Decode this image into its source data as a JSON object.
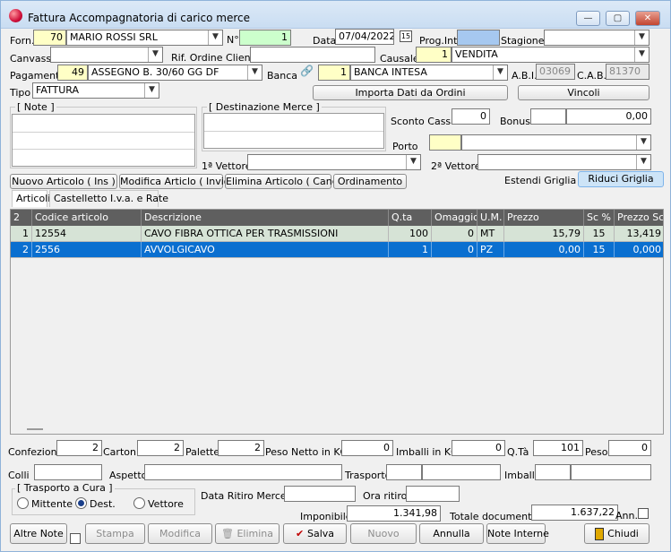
{
  "window": {
    "title": "Fattura Accompagnatoria di carico merce"
  },
  "header": {
    "forn_label": "Forn.",
    "forn_code": "70",
    "forn_name": "MARIO ROSSI SRL",
    "n_label": "N°",
    "n_value": "1",
    "data_label": "Data",
    "data_value": "07/04/2022",
    "calendar_icon": "15",
    "prog_label": "Prog.Int.",
    "prog_value": "",
    "stagione_label": "Stagione",
    "stagione_value": "",
    "canvass_label": "Canvass",
    "canvass_value": "",
    "rif_label": "Rif. Ordine Cliente",
    "rif_value": "",
    "causale_label": "Causale",
    "causale_code": "1",
    "causale_name": "VENDITA",
    "pagamento_label": "Pagamento",
    "pagamento_code": "49",
    "pagamento_name": "ASSEGNO B. 30/60 GG DF",
    "banca_label": "Banca",
    "banca_code": "1",
    "banca_name": "BANCA INTESA",
    "abi_label": "A.B.I.",
    "abi_value": "03069",
    "cab_label": "C.A.B.",
    "cab_value": "81370",
    "tipo_label": "Tipo",
    "tipo_value": "FATTURA",
    "importa_button": "Importa Dati da Ordini",
    "vincoli_button": "Vincoli",
    "note_title": "[ Note ]",
    "dest_title": "[ Destinazione Merce  ]",
    "sconto_label": "Sconto Cassa",
    "sconto_value": "0",
    "bonus_label": "Bonus",
    "bonus_value": "0,00",
    "porto_label": "Porto",
    "porto_code": "",
    "porto_name": "",
    "vettore1_label": "1ª Vettore",
    "vettore1_value": "",
    "vettore2_label": "2ª Vettore",
    "vettore2_value": ""
  },
  "toolbar": {
    "nuovo_articolo": "Nuovo Articolo ( Ins )",
    "modifica_articolo": "Modifica Articlo ( Invio )",
    "elimina_articolo": "Elimina Articolo ( Canc )",
    "ordinamento": "Ordinamento",
    "estendi": "Estendi Griglia",
    "riduci": "Riduci Griglia"
  },
  "tabs": [
    {
      "label": "Articoli"
    },
    {
      "label": "Castelletto I.v.a. e Rate"
    }
  ],
  "grid": {
    "columns": [
      "2",
      "Codice articolo",
      "Descrizione",
      "Q.ta",
      "Omaggio",
      "U.M.",
      "Prezzo",
      "Sc %",
      "Prezzo Sc"
    ],
    "rows": [
      {
        "n": "1",
        "codice": "12554",
        "descrizione": "CAVO FIBRA OTTICA PER TRASMISSIONI",
        "qta": "100",
        "omaggio": "0",
        "um": "MT",
        "prezzo": "15,79",
        "sc": "15",
        "prezzo_sc": "13,419"
      },
      {
        "n": "2",
        "codice": "2556",
        "descrizione": "AVVOLGICAVO",
        "qta": "1",
        "omaggio": "0",
        "um": "PZ",
        "prezzo": "0,00",
        "sc": "15",
        "prezzo_sc": "0,000"
      }
    ]
  },
  "footer": {
    "confezioni_label": "Confezioni",
    "confezioni_value": "2",
    "cartoni_label": "Cartoni",
    "cartoni_value": "2",
    "palette_label": "Palette",
    "palette_value": "2",
    "peso_netto_label": "Peso Netto in KG",
    "peso_netto_value": "0",
    "imballi_label": "Imballi in KG",
    "imballi_value": "0",
    "qta_label": "Q.Tà",
    "qta_value": "101",
    "peso_label": "Peso",
    "peso_value": "0",
    "colli_label": "Colli",
    "colli_value": "",
    "aspetto_label": "Aspetto",
    "aspetto_value": "",
    "trasporto_label": "Trasporto",
    "trasporto_value": "",
    "imballo_label": "Imballo",
    "imballo_value": "",
    "trasporto_cura_title": "[ Trasporto a Cura ]",
    "mittente_label": "Mittente",
    "dest_label": "Dest.",
    "vettore_label": "Vettore",
    "data_ritiro_label": "Data Ritiro Merce",
    "data_ritiro_value": "",
    "ora_ritiro_label": "Ora ritiro",
    "ora_ritiro_value": "",
    "imponibile_label": "Imponibile",
    "imponibile_value": "1.341,98",
    "totale_label": "Totale documento",
    "totale_value": "1.637,22",
    "ann_label": "Ann."
  },
  "actions": {
    "altre_note": "Altre Note",
    "stampa": "Stampa",
    "modifica": "Modifica",
    "elimina": "Elimina",
    "salva": "Salva",
    "nuovo": "Nuovo",
    "annulla": "Annulla",
    "note_interne": "Note Interne",
    "chiudi": "Chiudi"
  },
  "colors": {
    "selected_row": "#0a6fd0",
    "header_bg": "#5f5f5f",
    "yellow_field": "#ffffc6",
    "green_field": "#ccffcc"
  }
}
